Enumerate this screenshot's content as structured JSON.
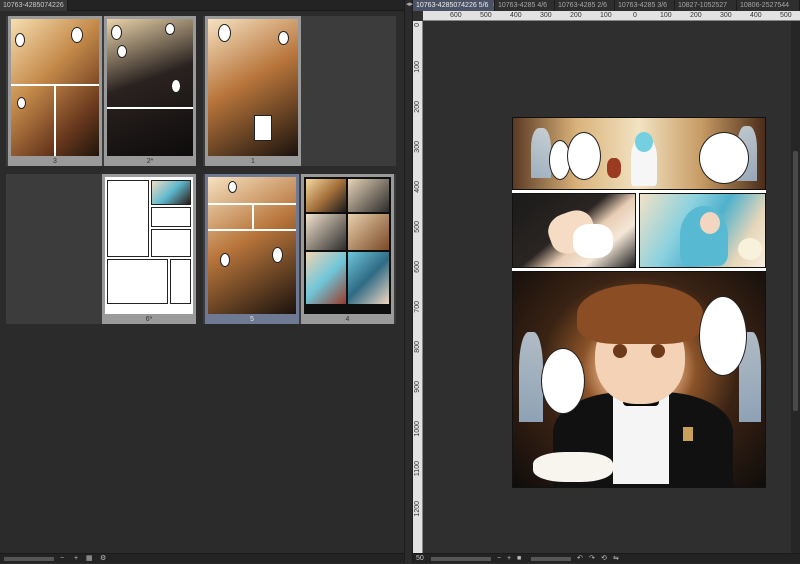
{
  "left_tabs": [
    {
      "label": "10763-4285074226"
    }
  ],
  "right_tabs": [
    {
      "label": "10763-4285074226 5/6",
      "active": true
    },
    {
      "label": "10763-4285 4/6",
      "active": false
    },
    {
      "label": "10763-4285 2/6",
      "active": false
    },
    {
      "label": "10763-4285 3/6",
      "active": false
    },
    {
      "label": "10827-1052527",
      "active": false
    },
    {
      "label": "10806-2527544",
      "active": false
    }
  ],
  "pages": [
    {
      "label": "3"
    },
    {
      "label": "2*"
    },
    {
      "label": "1"
    },
    {
      "label": "6*"
    },
    {
      "label": "5"
    },
    {
      "label": "4"
    }
  ],
  "ruler": {
    "top_ticks": [
      "600",
      "500",
      "400",
      "300",
      "200",
      "100",
      "0",
      "100",
      "200",
      "300",
      "400",
      "500"
    ],
    "left_ticks": [
      "0",
      "100",
      "200",
      "300",
      "400",
      "500",
      "600",
      "700",
      "800",
      "900",
      "1000",
      "1100",
      "1200"
    ]
  },
  "status": {
    "zoom_left": "",
    "zoom_right": "50"
  },
  "colors": {
    "selected_page": "#6e7a94",
    "active_tab": "#4b5266"
  }
}
